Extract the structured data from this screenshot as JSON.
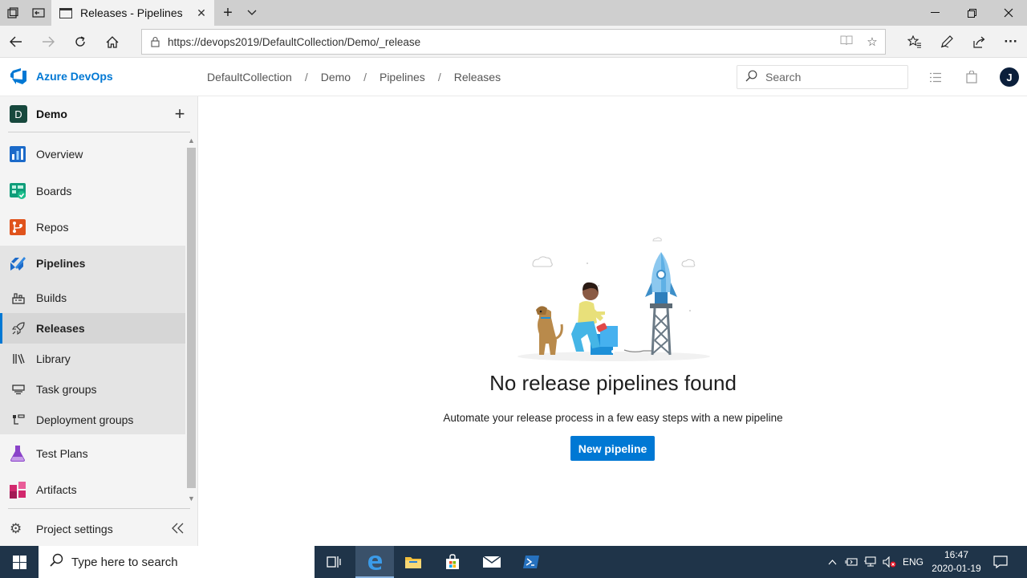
{
  "browser": {
    "tab_title": "Releases - Pipelines",
    "url": "https://devops2019/DefaultCollection/Demo/_release"
  },
  "header": {
    "brand": "Azure DevOps",
    "breadcrumbs": [
      "DefaultCollection",
      "Demo",
      "Pipelines",
      "Releases"
    ],
    "search_placeholder": "Search",
    "avatar_initial": "J"
  },
  "sidebar": {
    "project_initial": "D",
    "project_name": "Demo",
    "items": [
      {
        "label": "Overview",
        "icon": "overview-icon"
      },
      {
        "label": "Boards",
        "icon": "boards-icon"
      },
      {
        "label": "Repos",
        "icon": "repos-icon"
      },
      {
        "label": "Pipelines",
        "icon": "pipelines-icon"
      },
      {
        "label": "Builds",
        "icon": "builds-icon"
      },
      {
        "label": "Releases",
        "icon": "releases-icon"
      },
      {
        "label": "Library",
        "icon": "library-icon"
      },
      {
        "label": "Task groups",
        "icon": "task-groups-icon"
      },
      {
        "label": "Deployment groups",
        "icon": "deployment-groups-icon"
      },
      {
        "label": "Test Plans",
        "icon": "test-plans-icon"
      },
      {
        "label": "Artifacts",
        "icon": "artifacts-icon"
      }
    ],
    "selected": "Releases",
    "settings_label": "Project settings"
  },
  "main": {
    "empty_title": "No release pipelines found",
    "empty_desc": "Automate your release process in a few easy steps with a new pipeline",
    "new_button": "New pipeline"
  },
  "taskbar": {
    "search_placeholder": "Type here to search",
    "language": "ENG",
    "time": "16:47",
    "date": "2020-01-19"
  },
  "colors": {
    "accent": "#0078d4",
    "taskbar": "#1f3449"
  }
}
